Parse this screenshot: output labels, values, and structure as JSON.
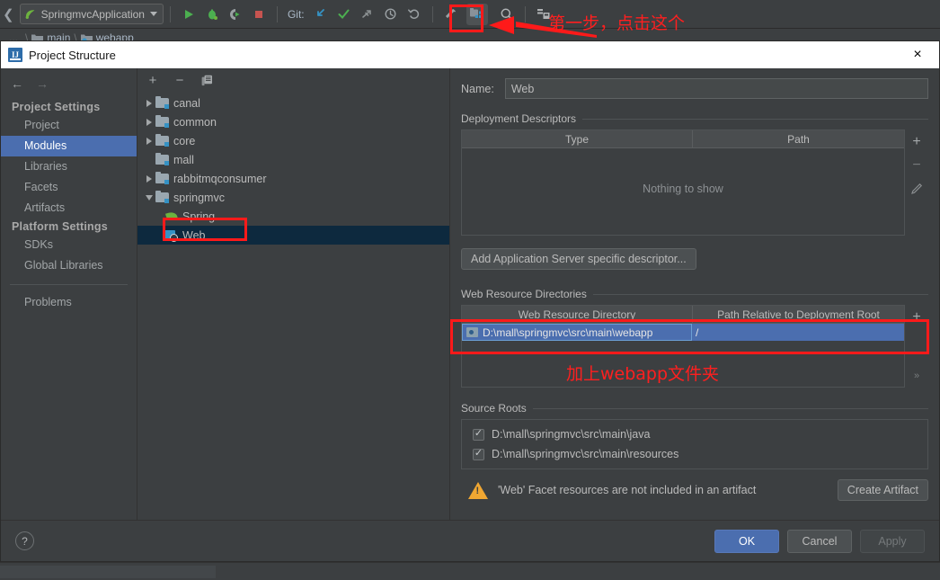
{
  "ide": {
    "run_config": "SpringmvcApplication",
    "git_label": "Git:",
    "toolbar_icons": [
      "run-icon",
      "debug-icon",
      "run-with-coverage-icon",
      "stop-icon",
      "update-project-icon",
      "commit-icon",
      "push-icon",
      "history-icon",
      "rollback-icon",
      "hammer-icon",
      "project-structure-icon",
      "search-everywhere-icon",
      "settings-sync-icon"
    ],
    "breadcrumb": [
      "...",
      "main",
      "webapp"
    ]
  },
  "dialog": {
    "title": "Project Structure",
    "close_label": "×"
  },
  "sidebar": {
    "back_arrow": "←",
    "forward_arrow": "→",
    "groups": [
      {
        "title": "Project Settings",
        "items": [
          {
            "label": "Project",
            "selected": false
          },
          {
            "label": "Modules",
            "selected": true
          },
          {
            "label": "Libraries",
            "selected": false
          },
          {
            "label": "Facets",
            "selected": false
          },
          {
            "label": "Artifacts",
            "selected": false
          }
        ]
      },
      {
        "title": "Platform Settings",
        "items": [
          {
            "label": "SDKs",
            "selected": false
          },
          {
            "label": "Global Libraries",
            "selected": false
          }
        ]
      }
    ],
    "problems": "Problems"
  },
  "module_tree": {
    "toolbar": {
      "add": "+",
      "remove": "−",
      "copy": "copy-icon"
    },
    "rows": [
      {
        "label": "canal",
        "indent": 0,
        "twisty": "right",
        "icon": "module-icon",
        "selected": false
      },
      {
        "label": "common",
        "indent": 0,
        "twisty": "right",
        "icon": "module-icon",
        "selected": false
      },
      {
        "label": "core",
        "indent": 0,
        "twisty": "right",
        "icon": "module-icon",
        "selected": false
      },
      {
        "label": "mall",
        "indent": 0,
        "twisty": "none",
        "icon": "module-icon",
        "selected": false
      },
      {
        "label": "rabbitmqconsumer",
        "indent": 0,
        "twisty": "right",
        "icon": "module-icon",
        "selected": false
      },
      {
        "label": "springmvc",
        "indent": 0,
        "twisty": "down",
        "icon": "module-icon",
        "selected": false
      },
      {
        "label": "Spring",
        "indent": 1,
        "twisty": "none",
        "icon": "spring-icon",
        "selected": false
      },
      {
        "label": "Web",
        "indent": 1,
        "twisty": "none",
        "icon": "web-facet-icon",
        "selected": true
      }
    ]
  },
  "facet": {
    "name_label": "Name:",
    "name_value": "Web",
    "deployment": {
      "section_title": "Deployment Descriptors",
      "columns": [
        "Type",
        "Path"
      ],
      "rows": [],
      "empty_text": "Nothing to show",
      "side_buttons": [
        "+",
        "−",
        "edit-pencil-icon"
      ]
    },
    "add_descriptor_button": "Add Application Server specific descriptor...",
    "web_resources": {
      "section_title": "Web Resource Directories",
      "columns": [
        "Web Resource Directory",
        "Path Relative to Deployment Root"
      ],
      "rows": [
        {
          "directory": "D:\\mall\\springmvc\\src\\main\\webapp",
          "relative_path": "/"
        }
      ],
      "side_buttons": [
        "+",
        "»"
      ]
    },
    "source_roots": {
      "section_title": "Source Roots",
      "items": [
        {
          "path": "D:\\mall\\springmvc\\src\\main\\java",
          "checked": true
        },
        {
          "path": "D:\\mall\\springmvc\\src\\main\\resources",
          "checked": true
        }
      ]
    },
    "warning": {
      "icon": "warning-triangle-icon",
      "text": "'Web' Facet resources are not included in an artifact",
      "action_button": "Create Artifact"
    }
  },
  "footer": {
    "help": "?",
    "ok": "OK",
    "cancel": "Cancel",
    "apply": "Apply"
  },
  "annotations": {
    "step1_text": "第一步，点击这个",
    "webapp_text": "加上webapp文件夹",
    "highlight_color": "#ff1a1a"
  }
}
